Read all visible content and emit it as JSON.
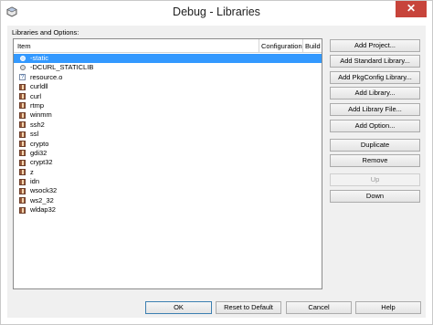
{
  "window": {
    "title": "Debug - Libraries",
    "close_glyph": "✕"
  },
  "section_label": "Libraries and Options:",
  "table": {
    "columns": [
      "Item",
      "Configuration",
      "Build"
    ],
    "rows": [
      {
        "label": "-static",
        "icon": "option-icon",
        "selected": true
      },
      {
        "label": "-DCURL_STATICLIB",
        "icon": "option-icon",
        "selected": false
      },
      {
        "label": "resource.o",
        "icon": "file-icon",
        "selected": false
      },
      {
        "label": "curldll",
        "icon": "library-icon",
        "selected": false
      },
      {
        "label": "curl",
        "icon": "library-icon",
        "selected": false
      },
      {
        "label": "rtmp",
        "icon": "library-icon",
        "selected": false
      },
      {
        "label": "winmm",
        "icon": "library-icon",
        "selected": false
      },
      {
        "label": "ssh2",
        "icon": "library-icon",
        "selected": false
      },
      {
        "label": "ssl",
        "icon": "library-icon",
        "selected": false
      },
      {
        "label": "crypto",
        "icon": "library-icon",
        "selected": false
      },
      {
        "label": "gdi32",
        "icon": "library-icon",
        "selected": false
      },
      {
        "label": "crypt32",
        "icon": "library-icon",
        "selected": false
      },
      {
        "label": "z",
        "icon": "library-icon",
        "selected": false
      },
      {
        "label": "idn",
        "icon": "library-icon",
        "selected": false
      },
      {
        "label": "wsock32",
        "icon": "library-icon",
        "selected": false
      },
      {
        "label": "ws2_32",
        "icon": "library-icon",
        "selected": false
      },
      {
        "label": "wldap32",
        "icon": "library-icon",
        "selected": false
      }
    ]
  },
  "side_buttons": {
    "add_project": "Add Project...",
    "add_standard_library": "Add Standard Library...",
    "add_pkgconfig_library": "Add PkgConfig Library...",
    "add_library": "Add Library...",
    "add_library_file": "Add Library File...",
    "add_option": "Add Option...",
    "duplicate": "Duplicate",
    "remove": "Remove",
    "up": "Up",
    "down": "Down"
  },
  "bottom_buttons": {
    "ok": "OK",
    "reset_to_default": "Reset to Default",
    "cancel": "Cancel",
    "help": "Help"
  },
  "colors": {
    "selection": "#3399ff",
    "close": "#c7443b"
  }
}
